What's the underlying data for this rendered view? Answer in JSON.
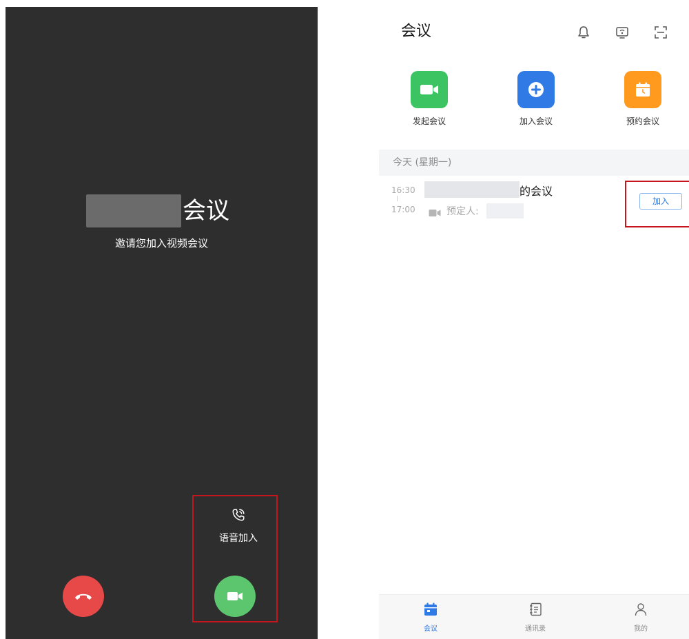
{
  "call_screen": {
    "title_suffix": "会议",
    "subtitle": "邀请您加入视频会议",
    "voice_join_label": "语音加入",
    "colors": {
      "background": "#2e2e2e",
      "hangup": "#e74848",
      "video": "#5cc66f"
    }
  },
  "app": {
    "title": "会议",
    "header_icons": [
      "bell-icon",
      "screen-share-icon",
      "scan-icon"
    ],
    "actions": [
      {
        "label": "发起会议",
        "icon": "video-camera-icon",
        "color": "#3cc463"
      },
      {
        "label": "加入会议",
        "icon": "plus-circle-icon",
        "color": "#2f7ae5"
      },
      {
        "label": "预约会议",
        "icon": "calendar-icon",
        "color": "#ff9a1f"
      }
    ],
    "section_label": "今天 (星期一)",
    "meeting": {
      "start_time": "16:30",
      "end_time": "17:00",
      "title_suffix": "的会议",
      "booker_label": "预定人:",
      "join_label": "加入"
    },
    "nav": [
      {
        "label": "会议",
        "icon": "calendar-icon",
        "active": true
      },
      {
        "label": "通讯录",
        "icon": "contacts-icon",
        "active": false
      },
      {
        "label": "我的",
        "icon": "user-icon",
        "active": false
      }
    ],
    "colors": {
      "accent": "#2f7ae5",
      "highlight": "#c4161c"
    }
  }
}
